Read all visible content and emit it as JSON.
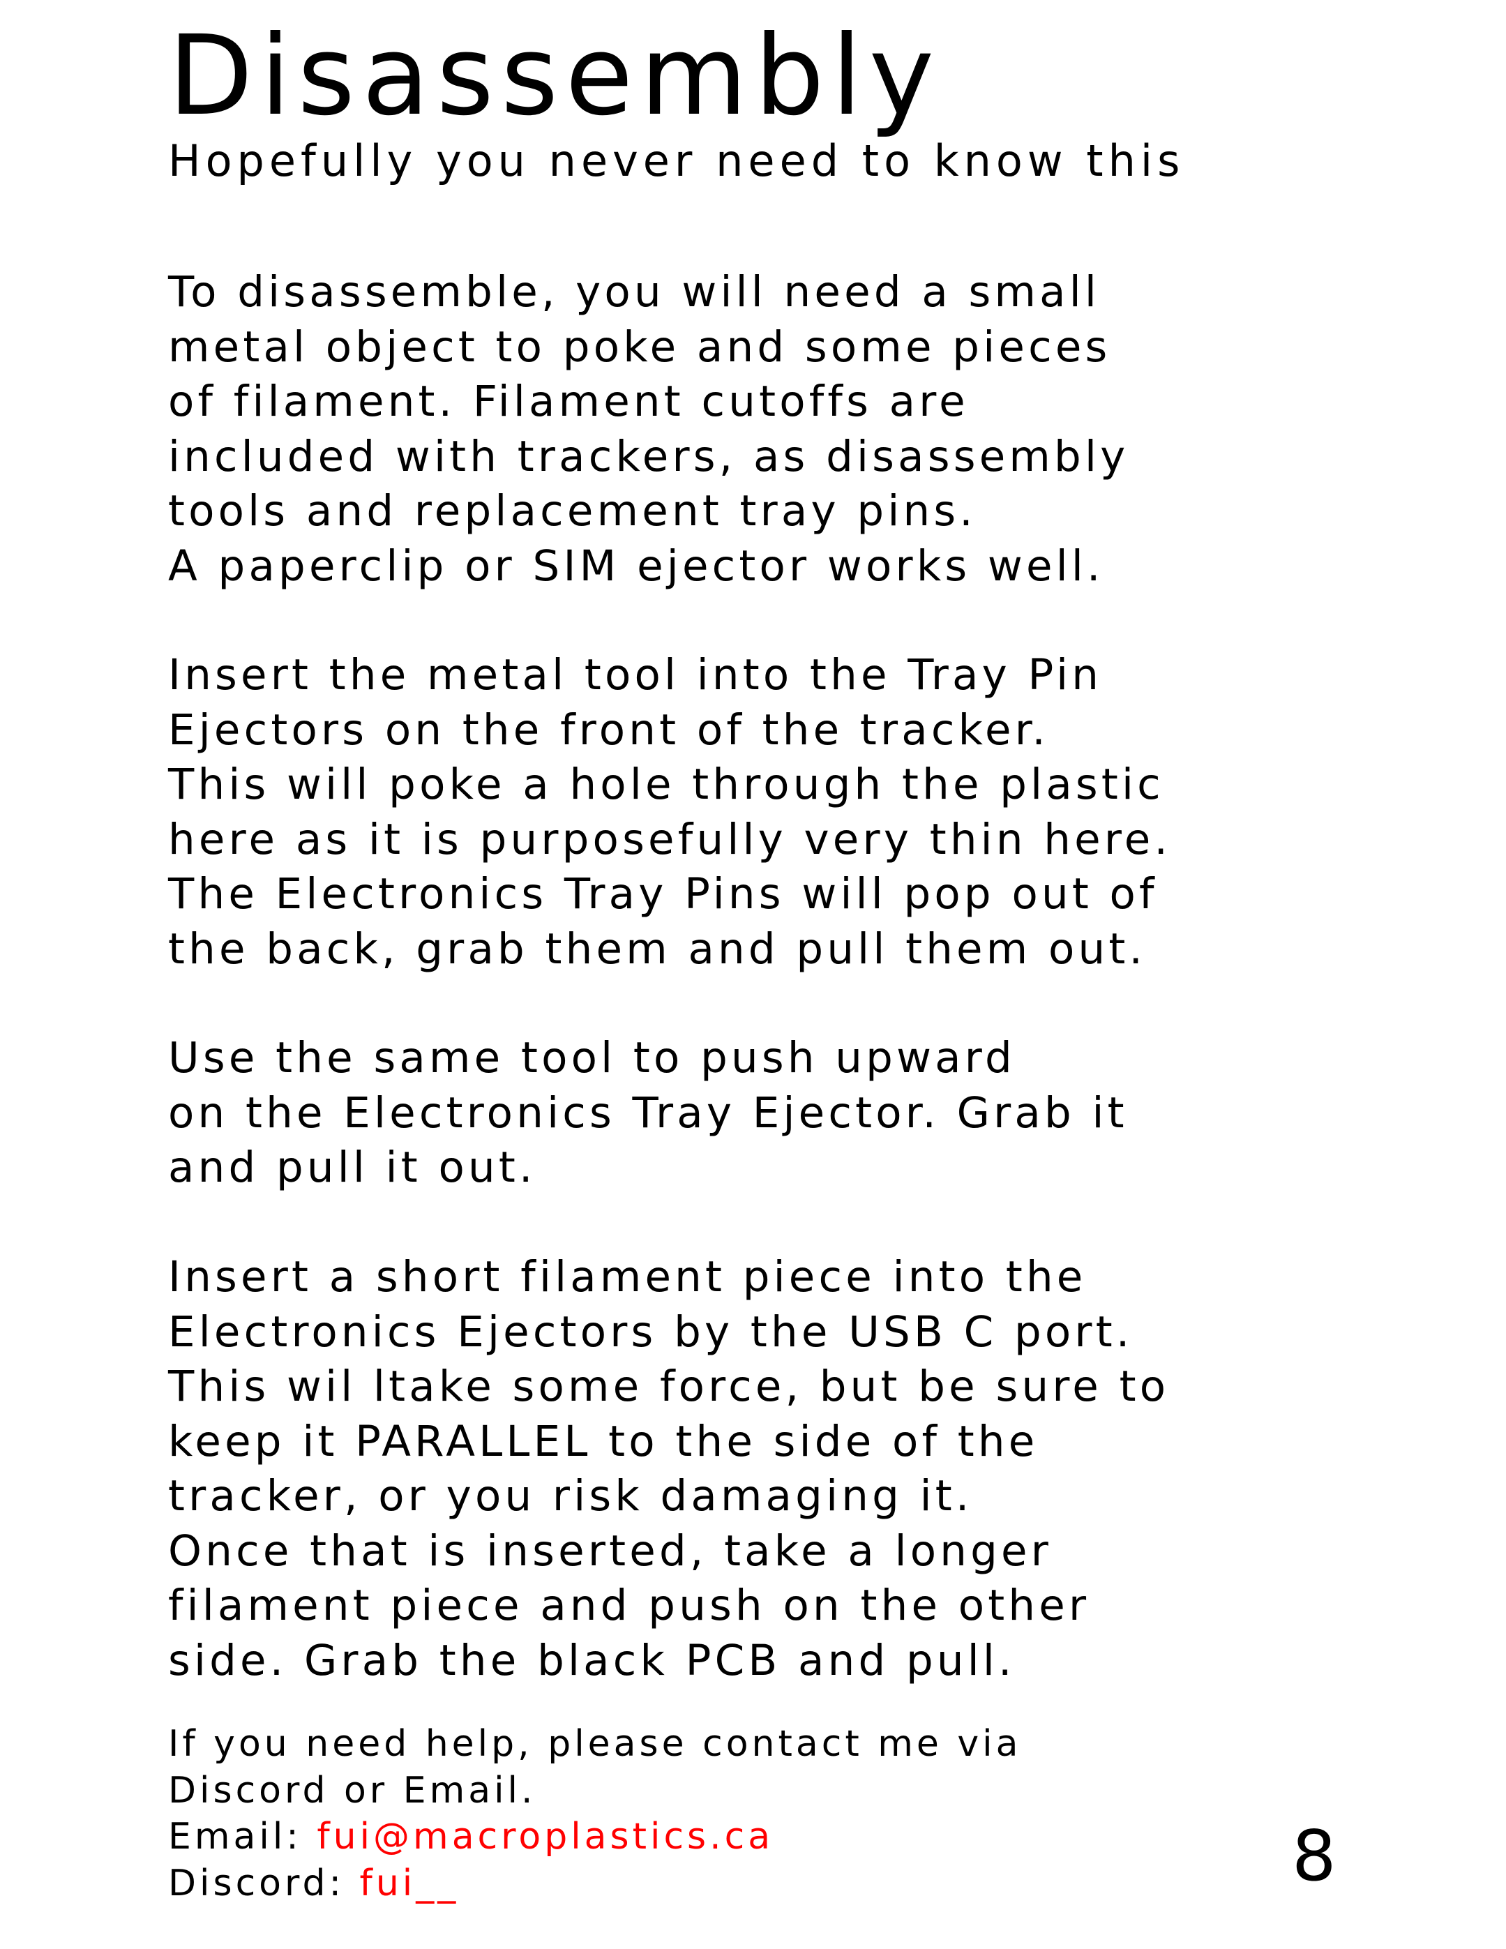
{
  "title": "Disassembly",
  "subtitle": "Hopefully you never need to know this",
  "paragraphs": [
    {
      "lines": [
        "To disassemble, you will need a small",
        "metal object to poke and some pieces",
        "of filament. Filament cutoffs are",
        "included with trackers, as disassembly",
        "tools and replacement tray pins.",
        "A paperclip or SIM ejector works well."
      ]
    },
    {
      "lines": [
        "Insert the metal tool into the Tray Pin",
        "Ejectors on the front of the tracker.",
        "This will poke a hole through the plastic",
        "here as it is purposefully very thin here.",
        "The Electronics Tray Pins will pop out of",
        "the back, grab them and pull them out."
      ]
    },
    {
      "lines": [
        "Use the same tool to push upward",
        "on the Electronics Tray Ejector. Grab it",
        "and pull it out."
      ]
    },
    {
      "lines": [
        "Insert a short filament piece into the",
        "Electronics Ejectors by the USB C port.",
        "This wil ltake some force, but be sure to",
        "keep it PARALLEL to the side of the",
        "tracker, or you risk damaging it.",
        "Once that is inserted, take a longer",
        "filament piece and push on the other",
        "side. Grab the black PCB and pull."
      ]
    }
  ],
  "contact": {
    "help_line_1": "If you need help, please contact me via",
    "help_line_2": "Discord or Email.",
    "email_label": "Email: ",
    "email_value": "fui@macroplastics.ca",
    "discord_label": "Discord: ",
    "discord_value": "fui__"
  },
  "page_number": "8",
  "colors": {
    "text": "#000000",
    "accent": "#ff0000",
    "background": "#ffffff"
  }
}
